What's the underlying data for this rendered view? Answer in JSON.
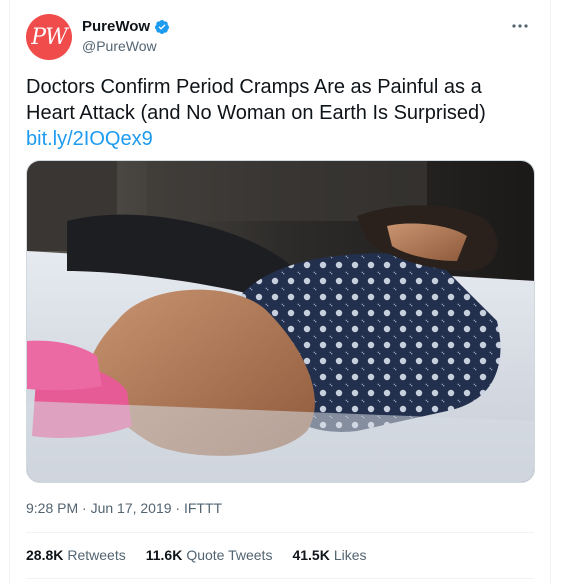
{
  "account": {
    "display_name": "PureWow",
    "handle": "@PureWow",
    "avatar_text": "PW",
    "brand_color": "#ef4c4b",
    "verified_color": "#1d9bf0"
  },
  "tweet": {
    "text": "Doctors Confirm Period Cramps Are as Painful as a Heart Attack (and No Woman on Earth Is Surprised)",
    "link": "bit.ly/2IOQex9",
    "meta": "9:28 PM · Jun 17, 2019 · IFTTT"
  },
  "stats": {
    "retweets_count": "28.8K",
    "retweets_label": "Retweets",
    "quotes_count": "11.6K",
    "quotes_label": "Quote Tweets",
    "likes_count": "41.5K",
    "likes_label": "Likes"
  },
  "icons": {
    "more": "more-icon",
    "verified": "verified-badge-icon"
  },
  "colors": {
    "text_primary": "#0f1419",
    "text_secondary": "#536471",
    "link": "#1d9bf0"
  }
}
